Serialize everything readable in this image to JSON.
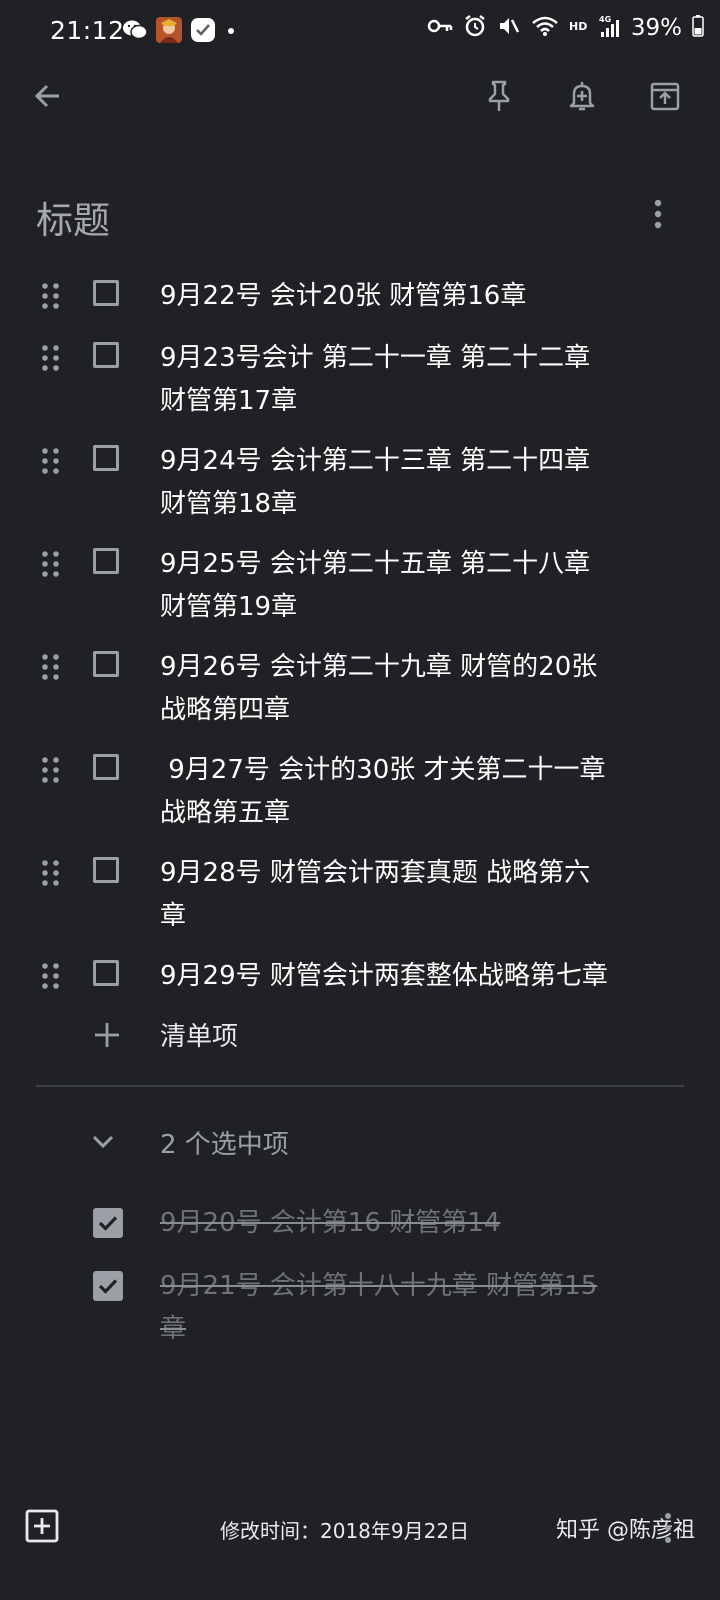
{
  "status_bar": {
    "time": "21:12",
    "battery": "39%",
    "left_icons": [
      "wechat-icon",
      "game-avatar-icon",
      "app-check-icon",
      "notification-dot-icon"
    ],
    "right_icons": [
      "key-icon",
      "alarm-icon",
      "mute-icon",
      "wifi-icon",
      "hd-icon",
      "signal-4g-icon",
      "battery-icon"
    ]
  },
  "toolbar": {
    "back": "back-arrow-icon",
    "pin": "pin-icon",
    "reminder": "reminder-bell-icon",
    "archive": "archive-icon"
  },
  "note": {
    "title": "标题",
    "items": [
      {
        "text": "9月22号 会计20张 财管第16章",
        "checked": false
      },
      {
        "text": "9月23号会计 第二十一章 第二十二章 财管第17章",
        "checked": false
      },
      {
        "text": "9月24号 会计第二十三章 第二十四章 财管第18章",
        "checked": false
      },
      {
        "text": "9月25号 会计第二十五章 第二十八章 财管第19章",
        "checked": false
      },
      {
        "text": "9月26号 会计第二十九章 财管的20张 战略第四章",
        "checked": false
      },
      {
        "text": " 9月27号 会计的30张 才关第二十一章 战略第五章",
        "checked": false
      },
      {
        "text": "9月28号 财管会计两套真题 战略第六章",
        "checked": false
      },
      {
        "text": "9月29号 财管会计两套整体战略第七章",
        "checked": false
      }
    ],
    "add_item_label": "清单项",
    "checked_count_label": "2 个选中项",
    "checked_items": [
      {
        "text": "9月20号 会计第16 财管第14",
        "checked": true
      },
      {
        "text": "9月21号 会计第十八十九章 财管第15章",
        "checked": true
      }
    ]
  },
  "bottom_bar": {
    "edited": "修改时间：2018年9月22日",
    "watermark": "知乎 @陈彦祖"
  },
  "colors": {
    "background": "#202124",
    "text": "#ffffff",
    "muted": "#9aa0a6"
  }
}
